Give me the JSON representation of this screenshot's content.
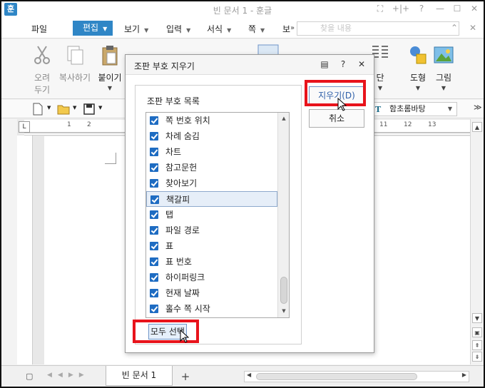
{
  "window": {
    "app_icon": "훈",
    "title": "빈 문서 1 - 훈글",
    "controls": [
      "⛶",
      "+|+",
      "?",
      "—",
      "☐",
      "✕"
    ]
  },
  "menubar": {
    "items": [
      {
        "label": "파일"
      },
      {
        "label": "편집"
      },
      {
        "label": "보기"
      },
      {
        "label": "입력"
      },
      {
        "label": "서식"
      },
      {
        "label": "쪽"
      },
      {
        "label": "보"
      }
    ],
    "overflow": "»",
    "search_placeholder": "찾을 내용",
    "right_controls": [
      "⌃",
      "✕"
    ]
  },
  "ribbon": {
    "buttons": [
      {
        "label_line1": "오려",
        "label_line2": "두기",
        "icon": "scissors-icon"
      },
      {
        "label_line1": "복사하기",
        "label_line2": "",
        "icon": "copy-icon"
      },
      {
        "label_line1": "붙이기",
        "label_line2": "",
        "icon": "paste-icon"
      },
      {
        "label_line1": "단",
        "label_line2": "",
        "icon": "columns-icon"
      },
      {
        "label_line1": "도형",
        "label_line2": "",
        "icon": "shapes-icon"
      },
      {
        "label_line1": "그림",
        "label_line2": "",
        "icon": "picture-icon"
      }
    ]
  },
  "toolbar2": {
    "font_name": "함초롬바탕",
    "font_icon": "T"
  },
  "ruler": {
    "h_numbers": [
      "1",
      "2",
      "11",
      "12",
      "13"
    ]
  },
  "bottombar": {
    "doc_tab": "빈 문서 1",
    "add_tab": "+"
  },
  "dialog": {
    "title": "조판 부호 지우기",
    "group_label": "조판 부호 목록",
    "items": [
      {
        "label": "쪽 번호 위치",
        "checked": true,
        "selected": false
      },
      {
        "label": "차례 숨김",
        "checked": true,
        "selected": false
      },
      {
        "label": "차트",
        "checked": true,
        "selected": false
      },
      {
        "label": "참고문헌",
        "checked": true,
        "selected": false
      },
      {
        "label": "찾아보기",
        "checked": true,
        "selected": false
      },
      {
        "label": "책갈피",
        "checked": true,
        "selected": true
      },
      {
        "label": "탭",
        "checked": true,
        "selected": false
      },
      {
        "label": "파일 경로",
        "checked": true,
        "selected": false
      },
      {
        "label": "표",
        "checked": true,
        "selected": false
      },
      {
        "label": "표 번호",
        "checked": true,
        "selected": false
      },
      {
        "label": "하이퍼링크",
        "checked": true,
        "selected": false
      },
      {
        "label": "현재 날짜",
        "checked": true,
        "selected": false
      },
      {
        "label": "홀수 쪽 시작",
        "checked": true,
        "selected": false
      }
    ],
    "erase_button": "지우기(D)",
    "cancel_button": "취소",
    "select_all_button": "모두 선택",
    "highlight_color": "#e8131b",
    "accent_color": "#2f86c6"
  }
}
